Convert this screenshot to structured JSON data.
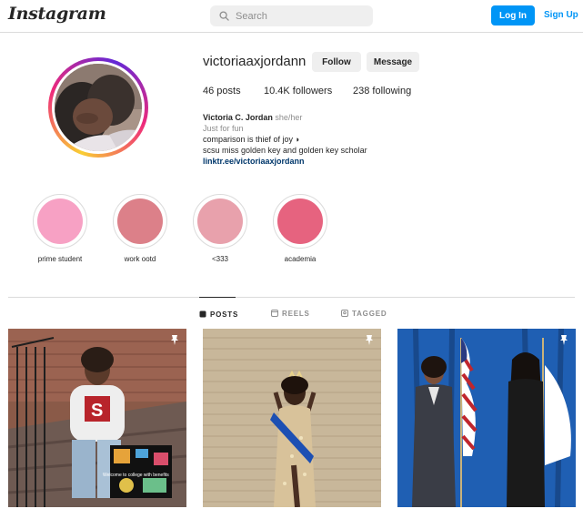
{
  "header": {
    "logo_text": "Instagram",
    "search_placeholder": "Search",
    "login_label": "Log In",
    "signup_label": "Sign Up"
  },
  "profile": {
    "username": "victoriaaxjordann",
    "follow_label": "Follow",
    "message_label": "Message",
    "stats": {
      "posts": "46 posts",
      "followers": "10.4K followers",
      "following": "238 following"
    },
    "full_name": "Victoria C. Jordan",
    "pronouns": "she/her",
    "category": "Just for fun",
    "bio_line1": "comparison is thief of joy ◗",
    "bio_line2": "scsu miss golden key and golden key scholar",
    "link": "linktr.ee/victoriaaxjordann"
  },
  "highlights": [
    {
      "label": "prime student",
      "color": "#f7a1c4"
    },
    {
      "label": "work ootd",
      "color": "#dc8089"
    },
    {
      "label": "<333",
      "color": "#e8a1ac"
    },
    {
      "label": "academia",
      "color": "#e6637f"
    }
  ],
  "tabs": [
    {
      "label": "POSTS",
      "icon": "grid-icon"
    },
    {
      "label": "REELS",
      "icon": "reels-icon"
    },
    {
      "label": "TAGGED",
      "icon": "tagged-icon"
    }
  ],
  "posts": [
    {
      "caption_sign": "Welcome to college with benefits",
      "pinned": true
    },
    {
      "pinned": true
    },
    {
      "pinned": true
    }
  ],
  "colors": {
    "accent": "#0095f6",
    "link": "#00376b",
    "muted": "#8e8e8e"
  }
}
